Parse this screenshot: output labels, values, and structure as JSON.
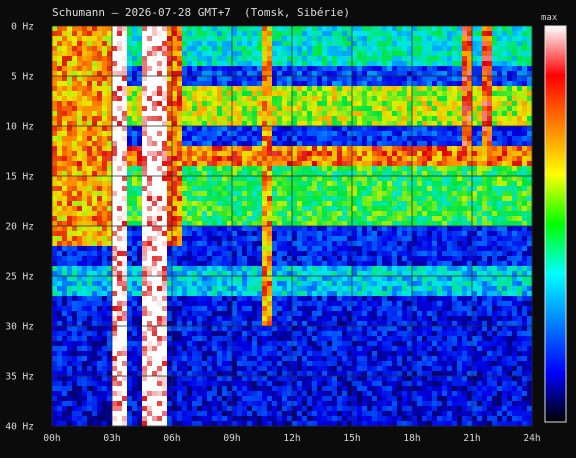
{
  "header": {
    "title": "Schumann — 2026-07-28 GMT+7  (Tomsk, Sibérie)"
  },
  "chart_data": {
    "type": "heatmap",
    "title": "Schumann — 2026-07-28 GMT+7  (Tomsk, Sibérie)",
    "xlabel": "",
    "ylabel": "",
    "x_ticks": [
      "00h",
      "03h",
      "06h",
      "09h",
      "12h",
      "15h",
      "18h",
      "21h",
      "24h"
    ],
    "y_ticks": [
      "0 Hz",
      "5 Hz",
      "10 Hz",
      "15 Hz",
      "20 Hz",
      "25 Hz",
      "30 Hz",
      "35 Hz",
      "40 Hz"
    ],
    "x_range_hours": [
      0,
      24
    ],
    "y_range_hz": [
      0,
      40
    ],
    "grid": true,
    "colorbar": {
      "label": "max",
      "colors": [
        "#ffffff",
        "#ff0000",
        "#ff8000",
        "#ffff00",
        "#00ff00",
        "#00ffff",
        "#0080ff",
        "#0000ff",
        "#000000"
      ]
    },
    "intensity_features": {
      "background_level": 0.25,
      "bands": [
        {
          "freq_from": 0,
          "freq_to": 4,
          "level": 0.45
        },
        {
          "freq_from": 6,
          "freq_to": 10,
          "level": 0.65
        },
        {
          "freq_from": 12,
          "freq_to": 14,
          "level": 0.8
        },
        {
          "freq_from": 14,
          "freq_to": 20,
          "level": 0.55
        },
        {
          "freq_from": 24,
          "freq_to": 27,
          "level": 0.4
        }
      ],
      "bursts": [
        {
          "hour_from": 0.0,
          "hour_to": 3.0,
          "freq_to": 22,
          "level": 0.75
        },
        {
          "hour_from": 3.0,
          "hour_to": 3.8,
          "freq_to": 40,
          "level": 1.0
        },
        {
          "hour_from": 4.4,
          "hour_to": 5.8,
          "freq_to": 40,
          "level": 1.0
        },
        {
          "hour_from": 5.8,
          "hour_to": 6.5,
          "freq_to": 22,
          "level": 0.8
        },
        {
          "hour_from": 10.5,
          "hour_to": 10.9,
          "freq_to": 30,
          "level": 0.75
        },
        {
          "hour_from": 20.5,
          "hour_to": 21.0,
          "freq_to": 12,
          "level": 0.85
        },
        {
          "hour_from": 21.5,
          "hour_to": 22.0,
          "freq_to": 12,
          "level": 0.85
        }
      ]
    }
  }
}
